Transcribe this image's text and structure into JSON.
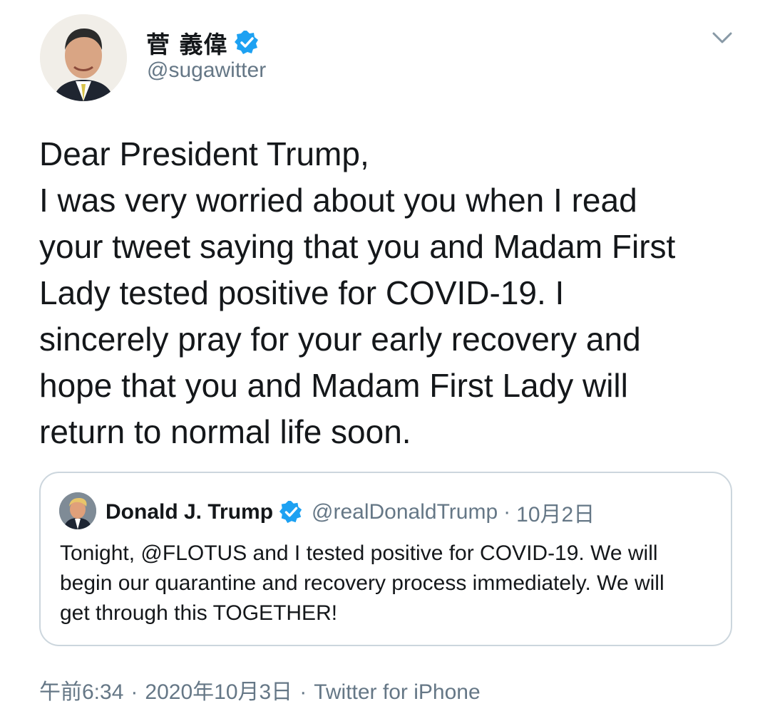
{
  "author": {
    "display_name": "菅 義偉",
    "handle": "@sugawitter",
    "verified": true,
    "avatar_icon": "person-photo-avatar"
  },
  "tweet": {
    "text": "Dear President Trump,\nI was very worried about you when I read\nyour tweet saying that you and Madam First\nLady tested positive for COVID-19. I\nsincerely pray for your early recovery and\nhope that you and Madam First Lady will\nreturn to normal life soon."
  },
  "quoted_tweet": {
    "display_name": "Donald J. Trump",
    "handle": "@realDonaldTrump",
    "separator": "·",
    "date": "10月2日",
    "verified": true,
    "text": "Tonight, @FLOTUS and I tested positive for COVID-19. We will\nbegin our quarantine and recovery process immediately. We will\nget through this TOGETHER!"
  },
  "meta": {
    "time": "午前6:34",
    "sep1": "·",
    "date": "2020年10月3日",
    "sep2": "·",
    "source": "Twitter for iPhone"
  },
  "colors": {
    "verified_blue": "#1da1f2",
    "secondary_text": "#657786",
    "border": "#ccd6dd"
  },
  "icons": {
    "verified": "verified-badge-icon",
    "caret": "chevron-down-icon"
  }
}
